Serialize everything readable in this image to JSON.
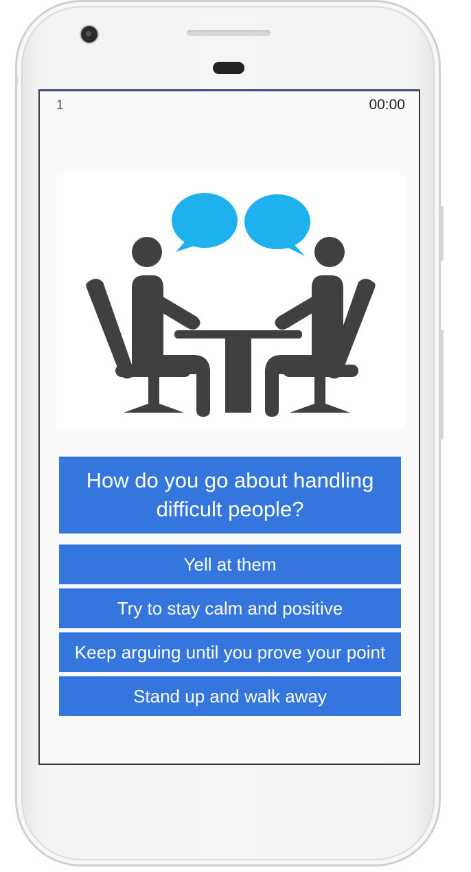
{
  "status": {
    "question_number": "1",
    "timer": "00:00"
  },
  "illustration": {
    "icon": "interview-meeting-illustration",
    "figure_color": "#404040",
    "bubble_color": "#1eb1ee"
  },
  "quiz": {
    "question": "How do you go about handling difficult people?",
    "answers": [
      "Yell at them",
      "Try to stay calm and positive",
      "Keep arguing until you prove your point",
      "Stand up and walk away"
    ],
    "accent_color": "#3476dd"
  }
}
